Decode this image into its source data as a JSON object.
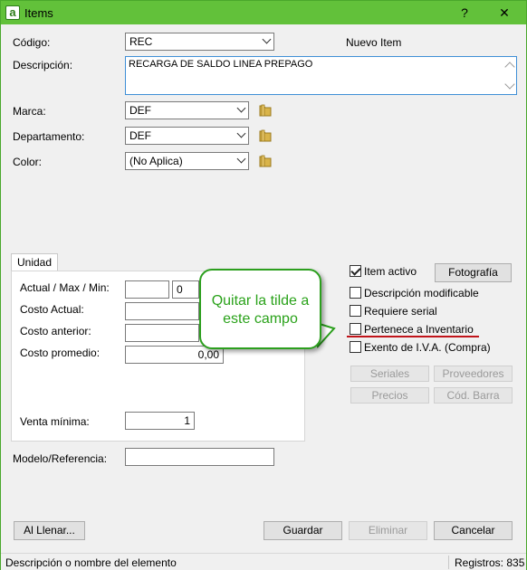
{
  "window": {
    "title": "Items",
    "help_label": "?",
    "close_label": "✕",
    "app_icon_glyph": "a"
  },
  "form": {
    "codigo_label": "Código:",
    "codigo_value": "REC",
    "new_item_label": "Nuevo Item",
    "descripcion_label": "Descripción:",
    "descripcion_value": "RECARGA DE SALDO LINEA PREPAGO",
    "marca_label": "Marca:",
    "marca_value": "DEF",
    "departamento_label": "Departamento:",
    "departamento_value": "DEF",
    "color_label": "Color:",
    "color_value": "(No Aplica)",
    "modelo_label": "Modelo/Referencia:",
    "modelo_value": ""
  },
  "unidad": {
    "tab_label": "Unidad",
    "actual_max_min_label": "Actual / Max / Min:",
    "actual_value": "",
    "max_value": "0",
    "costo_actual_label": "Costo Actual:",
    "costo_anterior_label": "Costo anterior:",
    "costo_promedio_label": "Costo promedio:",
    "costo_promedio_value": "0,00",
    "venta_minima_label": "Venta mínima:",
    "venta_minima_value": "1"
  },
  "options": {
    "item_activo": {
      "label": "Item activo",
      "checked": true
    },
    "descripcion_modificable": {
      "label": "Descripción modificable",
      "checked": false
    },
    "requiere_serial": {
      "label": "Requiere serial",
      "checked": false
    },
    "pertenece_inventario": {
      "label": "Pertenece a Inventario",
      "checked": false
    },
    "exento_iva": {
      "label": "Exento de I.V.A. (Compra)",
      "checked": false
    }
  },
  "side_buttons": {
    "fotografia": "Fotografía",
    "seriales": "Seriales",
    "proveedores": "Proveedores",
    "precios": "Precios",
    "cod_barra": "Cód. Barra"
  },
  "callout": {
    "line1": "Quitar la tilde a",
    "line2": "este campo",
    "color": "#2aa21a"
  },
  "footer_buttons": {
    "al_llenar": "Al Llenar...",
    "guardar": "Guardar",
    "eliminar": "Eliminar",
    "cancelar": "Cancelar"
  },
  "status": {
    "hint": "Descripción o nombre del elemento",
    "registros": "Registros: 835"
  },
  "colors": {
    "titlebar": "#62c13a",
    "accent_border": "#3f8fd6",
    "underline": "#c0141a"
  }
}
